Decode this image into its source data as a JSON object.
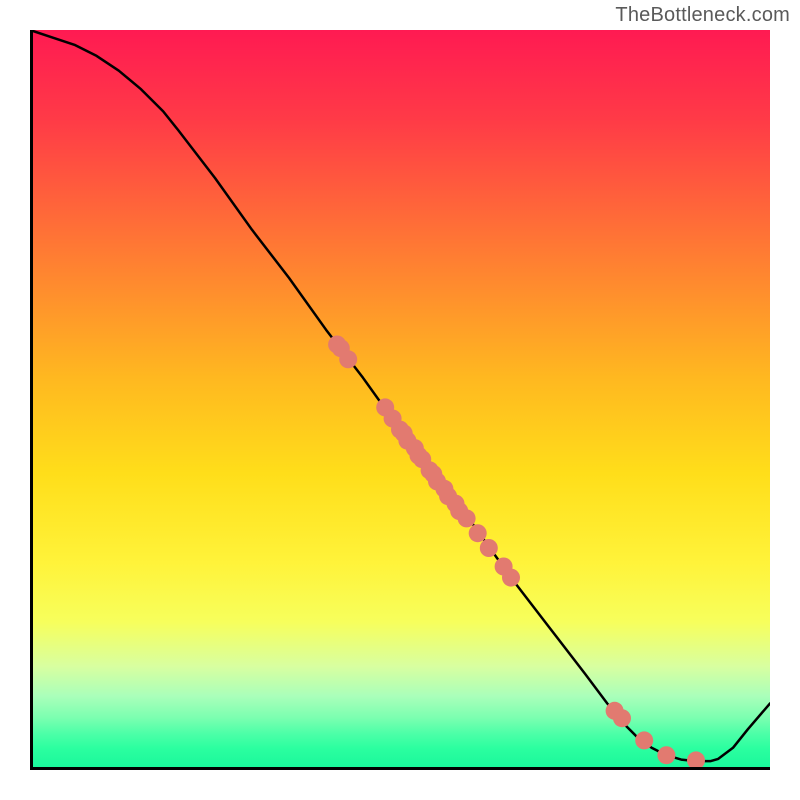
{
  "attribution": "TheBottleneck.com",
  "colors": {
    "gradient_top": "#ff1a52",
    "gradient_bottom": "#17f79a",
    "line": "#000000",
    "point_fill": "#e27a70",
    "point_stroke": "#c75a50"
  },
  "chart_data": {
    "type": "line",
    "xlabel": "",
    "ylabel": "",
    "xlim": [
      0,
      100
    ],
    "ylim": [
      0,
      100
    ],
    "title": "",
    "line_points": [
      {
        "x": 0,
        "y": 100
      },
      {
        "x": 3,
        "y": 99
      },
      {
        "x": 6,
        "y": 98
      },
      {
        "x": 9,
        "y": 96.5
      },
      {
        "x": 12,
        "y": 94.5
      },
      {
        "x": 15,
        "y": 92
      },
      {
        "x": 18,
        "y": 89
      },
      {
        "x": 20,
        "y": 86.5
      },
      {
        "x": 25,
        "y": 80
      },
      {
        "x": 30,
        "y": 73
      },
      {
        "x": 35,
        "y": 66.5
      },
      {
        "x": 40,
        "y": 59.5
      },
      {
        "x": 45,
        "y": 53
      },
      {
        "x": 50,
        "y": 46
      },
      {
        "x": 55,
        "y": 39.5
      },
      {
        "x": 60,
        "y": 33
      },
      {
        "x": 65,
        "y": 26
      },
      {
        "x": 70,
        "y": 19.5
      },
      {
        "x": 75,
        "y": 13
      },
      {
        "x": 78,
        "y": 9
      },
      {
        "x": 80,
        "y": 6.5
      },
      {
        "x": 82,
        "y": 4.5
      },
      {
        "x": 84,
        "y": 3
      },
      {
        "x": 86,
        "y": 2
      },
      {
        "x": 88,
        "y": 1.4
      },
      {
        "x": 90,
        "y": 1.2
      },
      {
        "x": 92,
        "y": 1.2
      },
      {
        "x": 93,
        "y": 1.5
      },
      {
        "x": 95,
        "y": 3
      },
      {
        "x": 97,
        "y": 5.5
      },
      {
        "x": 100,
        "y": 9
      }
    ],
    "scatter_points": [
      {
        "x": 41.5,
        "y": 57.5
      },
      {
        "x": 42,
        "y": 57
      },
      {
        "x": 43,
        "y": 55.5
      },
      {
        "x": 48,
        "y": 49
      },
      {
        "x": 49,
        "y": 47.5
      },
      {
        "x": 50,
        "y": 46
      },
      {
        "x": 50.5,
        "y": 45.5
      },
      {
        "x": 51,
        "y": 44.5
      },
      {
        "x": 52,
        "y": 43.5
      },
      {
        "x": 52.5,
        "y": 42.5
      },
      {
        "x": 53,
        "y": 42
      },
      {
        "x": 54,
        "y": 40.5
      },
      {
        "x": 54.5,
        "y": 40
      },
      {
        "x": 55,
        "y": 39
      },
      {
        "x": 56,
        "y": 38
      },
      {
        "x": 56.5,
        "y": 37
      },
      {
        "x": 57.5,
        "y": 36
      },
      {
        "x": 58,
        "y": 35
      },
      {
        "x": 59,
        "y": 34
      },
      {
        "x": 60.5,
        "y": 32
      },
      {
        "x": 62,
        "y": 30
      },
      {
        "x": 64,
        "y": 27.5
      },
      {
        "x": 65,
        "y": 26
      },
      {
        "x": 79,
        "y": 8
      },
      {
        "x": 80,
        "y": 7
      },
      {
        "x": 83,
        "y": 4
      },
      {
        "x": 86,
        "y": 2
      },
      {
        "x": 90,
        "y": 1.3
      }
    ]
  }
}
